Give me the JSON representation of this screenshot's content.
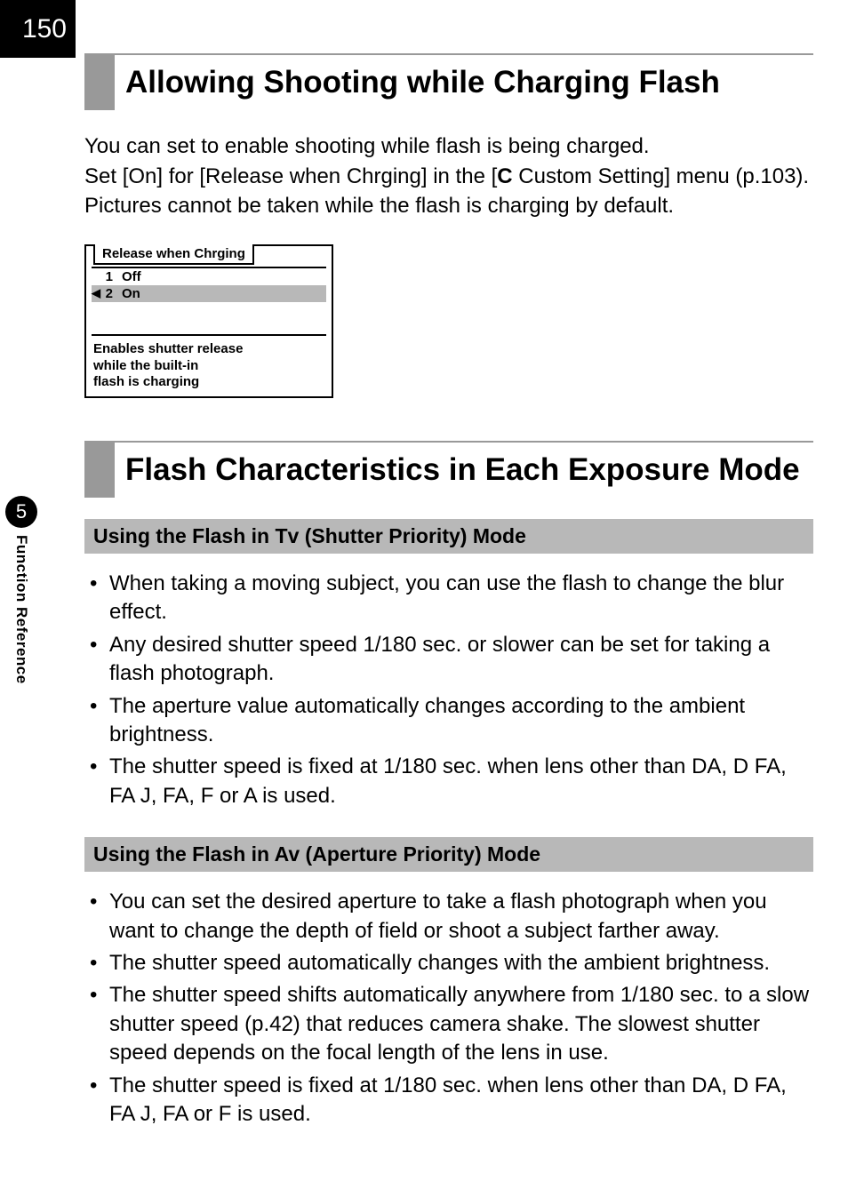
{
  "page_number": "150",
  "side": {
    "chapter": "5",
    "label": "Function Reference"
  },
  "section1": {
    "title": "Allowing Shooting while Charging Flash",
    "body_prefix": "You can set to enable shooting while flash is being charged.\nSet [On] for [Release when Chrging] in the [",
    "body_custom_icon": "C",
    "body_suffix": " Custom Setting] menu (p.103). Pictures cannot be taken while the flash is charging by default."
  },
  "menu": {
    "title": "Release when Chrging",
    "rows": [
      {
        "idx": "1",
        "label": "Off",
        "selected": false
      },
      {
        "idx": "2",
        "label": "On",
        "selected": true
      }
    ],
    "help1": "Enables shutter release",
    "help2": "while the built-in",
    "help3": "flash is charging"
  },
  "section2": {
    "title": "Flash Characteristics in Each Exposure Mode",
    "sub1": {
      "head_prefix": "Using the Flash in ",
      "head_mode": "Tv",
      "head_suffix": " (Shutter Priority) Mode",
      "items": [
        "When taking a moving subject, you can use the flash to change the blur effect.",
        "Any desired shutter speed 1/180 sec. or slower can be set for taking a flash photograph.",
        "The aperture value automatically changes according to the ambient brightness.",
        "The shutter speed is fixed at 1/180 sec. when lens other than DA, D FA, FA J, FA, F or A is used."
      ]
    },
    "sub2": {
      "head": "Using the Flash in Av (Aperture Priority) Mode",
      "items": [
        "You can set the desired aperture to take a flash photograph when you want to change the depth of field or shoot a subject farther away.",
        "The shutter speed automatically changes with the ambient brightness.",
        "The shutter speed shifts automatically anywhere from 1/180 sec. to a slow shutter speed (p.42) that reduces camera shake. The slowest shutter speed depends on the focal length of the lens in use.",
        "The shutter speed is fixed at 1/180 sec. when lens other than DA, D FA, FA J, FA or F is used."
      ]
    }
  }
}
